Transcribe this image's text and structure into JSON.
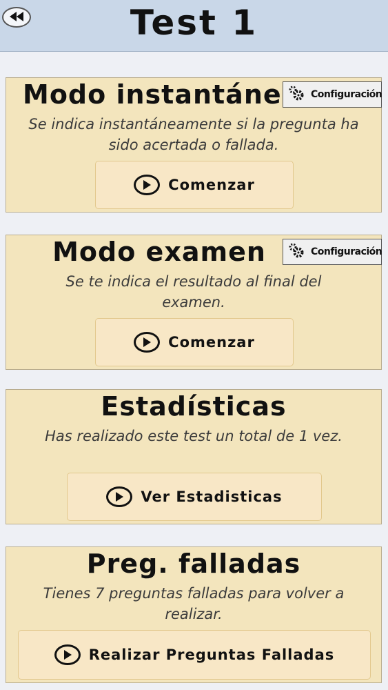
{
  "header": {
    "title": "Test 1",
    "back_icon": "rewind-icon"
  },
  "cards": [
    {
      "title": "Modo instantáneo",
      "description": "Se indica instantáneamente si la pregunta ha sido acertada o fallada.",
      "config_label": "Configuración",
      "button_label": "Comenzar"
    },
    {
      "title": "Modo examen",
      "description": "Se te indica el resultado al final del examen.",
      "config_label": "Configuración",
      "button_label": "Comenzar"
    },
    {
      "title": "Estadísticas",
      "description": "Has realizado este test un total de 1 vez.",
      "button_label": "Ver Estadisticas"
    },
    {
      "title": "Preg. falladas",
      "description": "Tienes 7 preguntas falladas para volver a realizar.",
      "button_label": "Realizar Preguntas Falladas"
    }
  ],
  "colors": {
    "header_bg": "#c9d7e8",
    "card_bg": "#f3e5bd",
    "button_bg": "#f8e7c6",
    "page_bg": "#eef0f5"
  }
}
